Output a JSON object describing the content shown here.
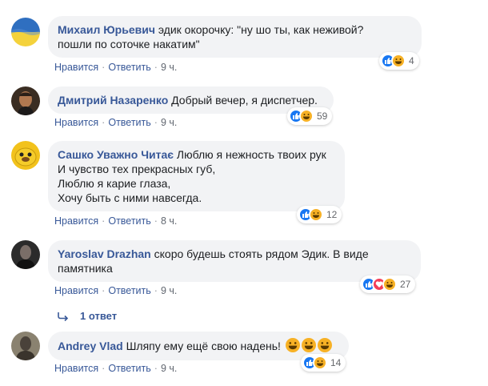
{
  "comments": [
    {
      "author": "Михаил Юрьевич",
      "lines": [
        "эдик окорочку: \"ну шо ты, как неживой?",
        "пошли по соточке накатим\""
      ],
      "like": "Нравится",
      "reply": "Ответить",
      "time": "9 ч.",
      "reactions_count": "4"
    },
    {
      "author": "Дмитрий Назаренко",
      "lines": [
        "Добрый вечер, я диспетчер."
      ],
      "like": "Нравится",
      "reply": "Ответить",
      "time": "9 ч.",
      "reactions_count": "59"
    },
    {
      "author": "Сашко Уважно Читає",
      "lines": [
        "Люблю я нежность твоих рук",
        "И чувство тех прекрасных губ,",
        "Люблю я карие глаза,",
        "Хочу быть с ними навсегда."
      ],
      "like": "Нравится",
      "reply": "Ответить",
      "time": "8 ч.",
      "reactions_count": "12"
    },
    {
      "author": "Yaroslav Drazhan",
      "lines": [
        "скоро будешь стоять рядом Эдик. В виде",
        "памятника"
      ],
      "like": "Нравится",
      "reply": "Ответить",
      "time": "9 ч.",
      "reactions_count": "27",
      "replies_label": "1 ответ"
    },
    {
      "author": "Andrey Vlad",
      "lines": [
        "Шляпу ему ещё свою наденьǃ"
      ],
      "like": "Нравится",
      "reply": "Ответить",
      "time": "9 ч.",
      "reactions_count": "14"
    }
  ],
  "colors": {
    "link": "#385898",
    "bubble": "#f2f3f5",
    "like": "#1877f2",
    "haha": "#f7b125",
    "love": "#f33e58"
  },
  "icons": [
    "ukraine-flag-avatar",
    "like-icon",
    "haha-icon",
    "love-icon",
    "reply-arrow-icon"
  ]
}
